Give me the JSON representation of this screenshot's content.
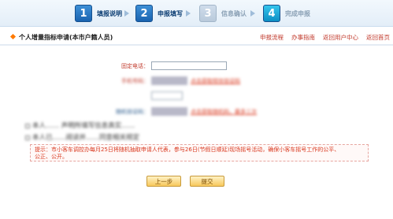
{
  "steps": [
    {
      "num": "1",
      "label": "填报说明"
    },
    {
      "num": "2",
      "label": "申报填写"
    },
    {
      "num": "3",
      "label": "信息确认"
    },
    {
      "num": "4",
      "label": "完成申报"
    }
  ],
  "header": {
    "title": "个人增量指标申请(本市户籍人员)",
    "links": [
      "申报流程",
      "办事指南",
      "返回用户中心",
      "返回首页"
    ]
  },
  "form": {
    "phone_label": "固定电话：",
    "mobile_label": "手机号码：",
    "mobile_link": "点击获取短信验证码",
    "code_label": "随机验证码：",
    "code_link": "点击获取随机码，最多三次",
    "agree_line1": "本人…… 声明所填写信息真实……",
    "agree_line2": "本人已……阅读并……同意相关规定"
  },
  "notice": {
    "line1": "提示：市小客车调控办每月25日将随机抽取申请人代表，参与26日(节假日顺延)现场摇号活动，确保小客车摇号工作的公平、",
    "line2": "公正、公开。"
  },
  "buttons": {
    "prev": "上一步",
    "submit": "提交"
  }
}
